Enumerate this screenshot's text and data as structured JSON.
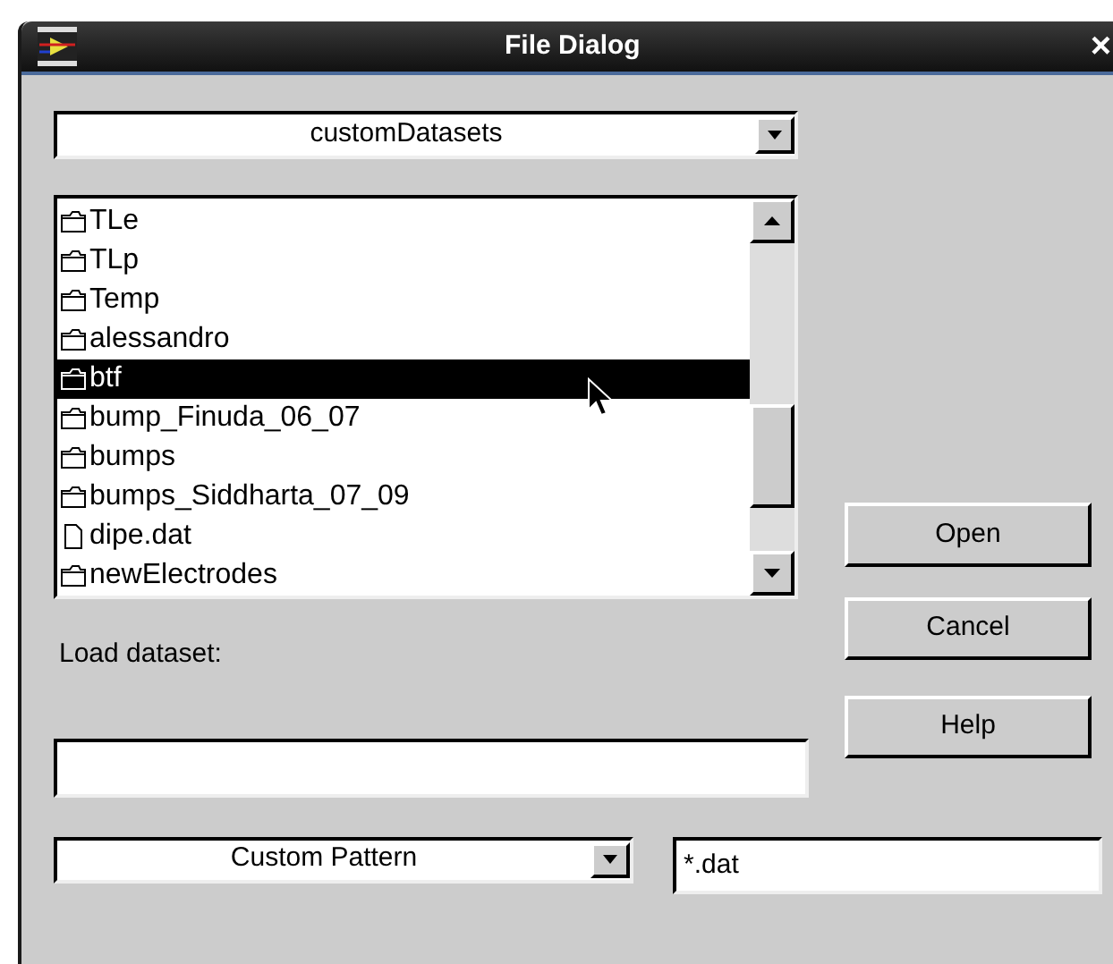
{
  "window": {
    "title": "File Dialog",
    "close": "×"
  },
  "directory": {
    "value": "customDatasets"
  },
  "files": [
    {
      "name": "TLe",
      "kind": "folder",
      "selected": false
    },
    {
      "name": "TLp",
      "kind": "folder",
      "selected": false
    },
    {
      "name": "Temp",
      "kind": "folder",
      "selected": false
    },
    {
      "name": "alessandro",
      "kind": "folder",
      "selected": false
    },
    {
      "name": "btf",
      "kind": "folder",
      "selected": true
    },
    {
      "name": "bump_Finuda_06_07",
      "kind": "folder",
      "selected": false
    },
    {
      "name": "bumps",
      "kind": "folder",
      "selected": false
    },
    {
      "name": "bumps_Siddharta_07_09",
      "kind": "folder",
      "selected": false
    },
    {
      "name": "dipe.dat",
      "kind": "file",
      "selected": false
    },
    {
      "name": "newElectrodes",
      "kind": "folder",
      "selected": false
    }
  ],
  "load_label": "Load dataset:",
  "filter": {
    "value": "Custom Pattern"
  },
  "pattern": {
    "value": "*.dat"
  },
  "buttons": [
    "Open",
    "Cancel",
    "Help"
  ]
}
